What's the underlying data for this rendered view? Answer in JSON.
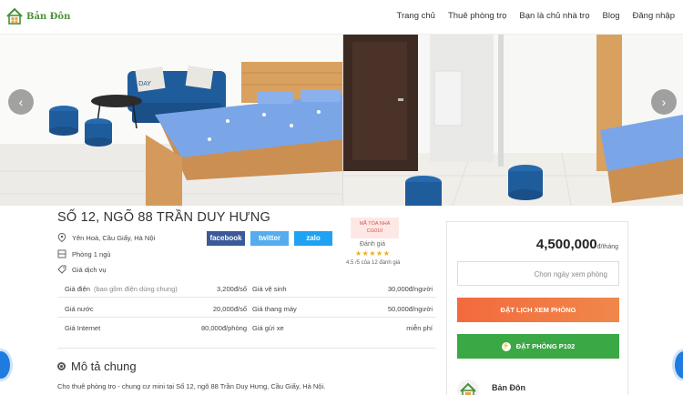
{
  "header": {
    "logo_text": "Bản Đôn",
    "nav": [
      "Trang chủ",
      "Thuê phòng trọ",
      "Bạn là chủ nhà trọ",
      "Blog",
      "Đăng nhập"
    ]
  },
  "gallery": {
    "prev_icon": "chevron-left-icon",
    "next_icon": "chevron-right-icon",
    "pillow_text": "DAY"
  },
  "listing": {
    "title": "SỐ 12, NGÕ 88 TRẦN DUY HƯNG",
    "address": "Yên Hoà, Cầu Giấy, Hà Nội",
    "rooms": "Phòng 1 ngủ",
    "services_label": "Giá dịch vụ"
  },
  "share": {
    "facebook": "facebook",
    "twitter": "twitter",
    "zalo": "zalo"
  },
  "badge": {
    "code_line1": "MÃ TÒA NHÀ",
    "code_line2": "CG010",
    "rating_label": "Đánh giá",
    "stars": "★★★★★",
    "rating_text": "4.5 /5 của 12 đánh giá"
  },
  "fees": [
    {
      "label": "Giá điện",
      "note": "(bao gồm điện dùng chung)",
      "value": "3,200đ/số",
      "label2": "Giá vệ sinh",
      "value2": "30,000đ/người"
    },
    {
      "label": "Giá nước",
      "note": "",
      "value": "20,000đ/số",
      "label2": "Giá thang máy",
      "value2": "50,000đ/người"
    },
    {
      "label": "Giá Internet",
      "note": "",
      "value": "80,000đ/phòng",
      "label2": "Giá gửi xe",
      "value2": "miễn phí"
    }
  ],
  "description": {
    "title": "Mô tả chung",
    "text": "Cho thuê phòng trọ - chung cư mini tại Số 12, ngõ 88 Trần Duy Hưng, Cầu Giấy, Hà Nội."
  },
  "booking": {
    "price": "4,500,000",
    "price_unit": "đ/tháng",
    "date_placeholder": "Chọn ngày xem phòng",
    "schedule_button": "ĐẶT LỊCH XEM PHÒNG",
    "book_button": "ĐẶT PHÒNG P102",
    "owner_name": "Bản Đôn"
  },
  "colors": {
    "brand_green": "#4a8f3c",
    "orange": "#f26a3e",
    "green_button": "#3aa844",
    "facebook": "#3b5998",
    "twitter": "#55acee",
    "zalo": "#1fa2f2",
    "star": "#f0ad1a"
  }
}
